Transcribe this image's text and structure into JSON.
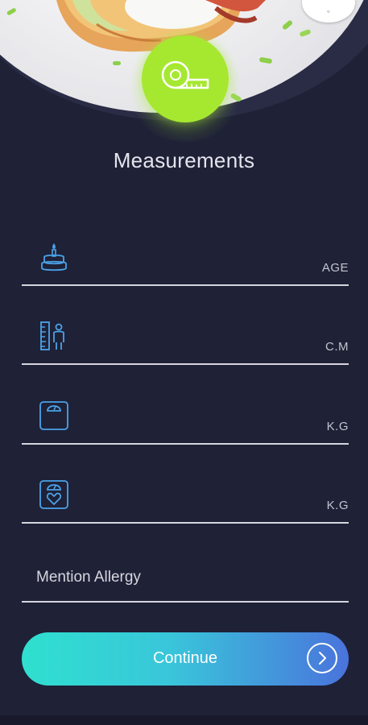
{
  "screen": {
    "title": "Measurements"
  },
  "badge": {
    "icon": "measuring-tape-icon"
  },
  "fields": [
    {
      "icon": "birthday-cake-icon",
      "unit": "AGE"
    },
    {
      "icon": "height-ruler-icon",
      "unit": "C.M"
    },
    {
      "icon": "weight-scale-icon",
      "unit": "K.G"
    },
    {
      "icon": "target-weight-scale-icon",
      "unit": "K.G"
    }
  ],
  "allergy": {
    "label": "Mention Allergy"
  },
  "continue_button": {
    "label": "Continue",
    "icon": "arrow-right-circle-icon"
  },
  "colors": {
    "background": "#1f2137",
    "accent_green": "#a6e830",
    "icon_blue": "#4aa3e8",
    "button_gradient_start": "#2fe0cf",
    "button_gradient_end": "#4a73dc"
  }
}
